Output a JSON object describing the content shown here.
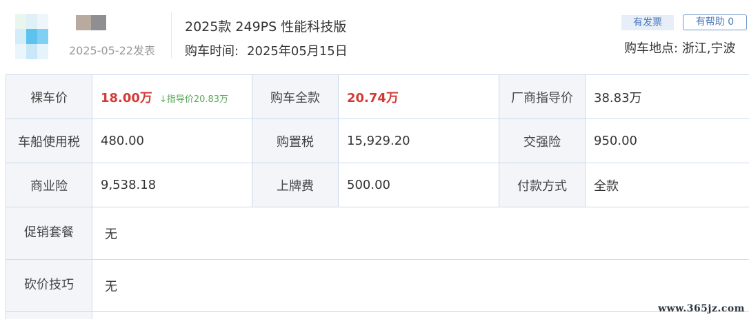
{
  "review": {
    "post_date": "2025-05-22发表",
    "model": "2025款 249PS 性能科技版",
    "buy_time_label": "购车时间:",
    "buy_time_value": "2025年05月15日",
    "invoice_badge": "有发票",
    "helpful_button": "有帮助 0",
    "buy_place": "购车地点: 浙江,宁波"
  },
  "price_table": {
    "rows": [
      [
        {
          "label": "裸车价",
          "value": "18.00万",
          "note": "↓指导价20.83万"
        },
        {
          "label": "购车全款",
          "value": "20.74万"
        },
        {
          "label": "厂商指导价",
          "value": "38.83万"
        }
      ],
      [
        {
          "label": "车船使用税",
          "value": "480.00"
        },
        {
          "label": "购置税",
          "value": "15,929.20"
        },
        {
          "label": "交强险",
          "value": "950.00"
        }
      ],
      [
        {
          "label": "商业险",
          "value": "9,538.18"
        },
        {
          "label": "上牌费",
          "value": "500.00"
        },
        {
          "label": "付款方式",
          "value": "全款"
        }
      ]
    ],
    "promotion_label": "促销套餐",
    "promotion_value": "无",
    "bargain_label": "砍价技巧",
    "bargain_value": "无"
  },
  "watermark": "www.365jz.com",
  "colors": {
    "highlight_red": "#d33a35",
    "guide_green": "#5aa85a",
    "label_bg": "#f4f5f9",
    "border": "#c9d9ea",
    "link_blue": "#4a78b8"
  }
}
